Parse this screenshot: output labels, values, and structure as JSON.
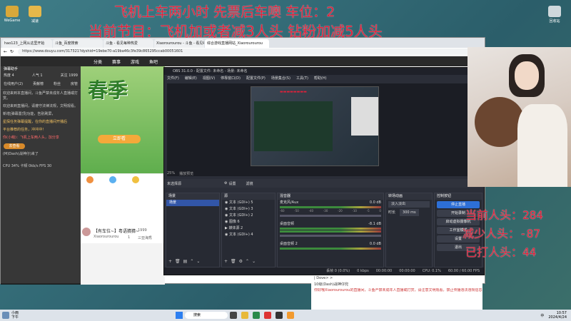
{
  "overlay": {
    "line1": "飞机上车两小时  先票后车噢 车位：2",
    "line2": "当前节目：飞机加或者减3人头 钻粉加减5人头",
    "current_heads": "当前人头：284",
    "reduced_heads": "减少人头：-87",
    "hit_heads": "已打人头：44"
  },
  "desktop": {
    "icons": [
      {
        "label": "WeGame",
        "color": "#d8a83a"
      },
      {
        "label": "减速",
        "color": "#e6b84a"
      }
    ],
    "recycle_label": "回收站"
  },
  "browser": {
    "tabs": [
      {
        "label": "hao123_上网从这里开始"
      },
      {
        "label": "斗鱼_百度搜索"
      },
      {
        "label": "斗鱼 - 看见每种热爱"
      },
      {
        "label": "Xiaorourourou - 斗鱼 - 看见每种热"
      },
      {
        "label": "综合游戏直播网站_Xiaorourourou"
      }
    ],
    "url": "https://www.douyu.com/317321?dyshid=19ebe70-a19ba46c3fe39c865295ccab00051601",
    "nav": [
      "分类",
      "赛事",
      "游戏",
      "鱼吧"
    ],
    "sidebar_title": "弹幕助手",
    "stats": {
      "hot_label": "热度 4",
      "people_label": "人气 1",
      "follow_label": "关注 1999"
    },
    "sidebar_tabs": [
      "在线用户(2)",
      "贡献榜",
      "粉丝",
      "房管"
    ],
    "chat": [
      "欢迎来到本直播间，斗鱼严禁未成年人直播或打赏。",
      "欢迎来到直播间，请遵守法律法规，文明观看。",
      "新增|弹幕置顶|功能，告别刷屏，",
      "星探任务弹幕提醒，在你的直播间开播后",
      "平台推荐的任务，冲冲冲！",
      "你(小萌)：飞机上车两人头，加分享",
      "(M)Dash(战神仔)来了"
    ],
    "user_badge": "去查看",
    "stream_title": "【有车位~】粤语猜猜~",
    "streamer": "Xiaorourourou",
    "fans": "1999",
    "banner_text": "春季",
    "cta": "立即看",
    "status_row": "CPU 34%  卡顿 0kb/s  FPS 30",
    "score": "1",
    "tag": "三亚海秀"
  },
  "obs": {
    "title": "OBS 31.0.0 - 配置文件: 未命名 - 场景: 未命名",
    "menu": [
      "文件(F)",
      "编辑(E)",
      "视图(V)",
      "停靠窗口(D)",
      "配置文件(P)",
      "场景集合(S)",
      "工具(T)",
      "帮助(H)"
    ],
    "zoom_label": "25%",
    "preview_label": "播放预览",
    "source_bar": {
      "none_label": "未选择源",
      "settings": "设置",
      "filters": "滤镜"
    },
    "scenes": {
      "title": "场景",
      "items": [
        "场景"
      ]
    },
    "sources": {
      "title": "源",
      "items": [
        "文本 (GDI+) 5",
        "文本 (GDI+) 3",
        "文本 (GDI+) 2",
        "图像 6",
        "媒体源 2",
        "文本 (GDI+) 4"
      ]
    },
    "mixer": {
      "title": "混音器",
      "channels": [
        {
          "name": "麦克风/Aux",
          "db": "0.0 dB"
        },
        {
          "name": "桌面音频",
          "db": "-8.1 dB"
        },
        {
          "name": "桌面音频 2",
          "db": "0.0 dB"
        }
      ],
      "scale": [
        "-60",
        "-50",
        "-40",
        "-30",
        "-20",
        "-10",
        "-5",
        "0"
      ]
    },
    "transitions": {
      "title": "转场动画",
      "type": "淡入淡出",
      "duration_label": "时长",
      "duration": "300 ms"
    },
    "controls": {
      "title": "控制按钮",
      "buttons": [
        "停止直播",
        "开始录制",
        "启动虚拟摄像机",
        "工作室模式",
        "设置",
        "退出"
      ]
    },
    "status": {
      "dropped": "丢帧 0 (0.0%)",
      "kbps": "0 kbps",
      "stream_time": "00:00:00",
      "rec_time": "00:00:00",
      "cpu": "CPU: 0.1%",
      "fps": "60.00 / 60.00 FPS"
    }
  },
  "bg_page": {
    "lines": [
      "| Dove> >",
      "10级(Dash)战神仔兜",
      "你好哦Xiaorourourou的直播间，斗鱼严禁未成年人直播或打赏，请注意文明观看，禁止传播违法违规信息"
    ]
  },
  "taskbar": {
    "weather_label": "小雨",
    "weather_sub": "下午",
    "search": "搜索",
    "lang": "中",
    "time": "10:57",
    "date": "2024/4/24"
  }
}
